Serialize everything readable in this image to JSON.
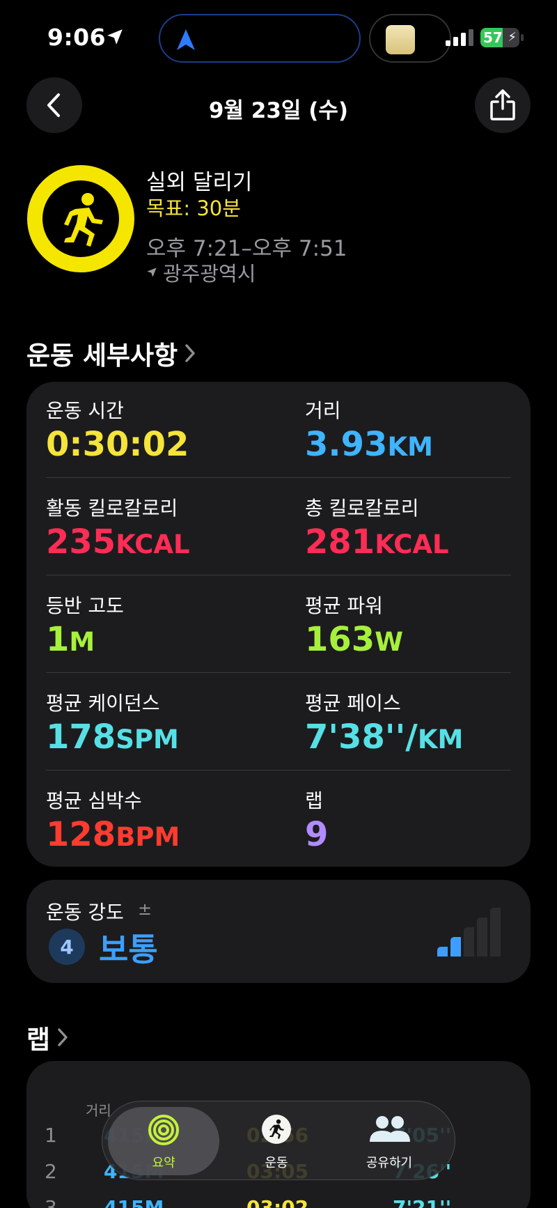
{
  "status_bar": {
    "time": "9:06",
    "battery": "57"
  },
  "nav": {
    "title": "9월 23일 (수)"
  },
  "workout": {
    "name": "실외 달리기",
    "goal": "목표: 30분",
    "time_range": "오후 7:21–오후 7:51",
    "location": "광주광역시"
  },
  "details": {
    "title": "운동 세부사항",
    "metrics": [
      {
        "label": "운동 시간",
        "value": "0:30:02",
        "unit": "",
        "color": "#f5e43a"
      },
      {
        "label": "거리",
        "value": "3.93",
        "unit": "KM",
        "color": "#3fb4ff"
      },
      {
        "label": "활동 킬로칼로리",
        "value": "235",
        "unit": "KCAL",
        "color": "#ff2d55"
      },
      {
        "label": "총 킬로칼로리",
        "value": "281",
        "unit": "KCAL",
        "color": "#ff2d55"
      },
      {
        "label": "등반 고도",
        "value": "1",
        "unit": "M",
        "color": "#a6f03b"
      },
      {
        "label": "평균 파워",
        "value": "163",
        "unit": "W",
        "color": "#a6f03b"
      },
      {
        "label": "평균 케이던스",
        "value": "178",
        "unit": "SPM",
        "color": "#56e0e6"
      },
      {
        "label": "평균 페이스",
        "value": "7'38''/",
        "unit": "KM",
        "color": "#56e0e6"
      },
      {
        "label": "평균 심박수",
        "value": "128",
        "unit": "BPM",
        "color": "#ff3b30"
      },
      {
        "label": "랩",
        "value": "9",
        "unit": "",
        "color": "#b18cff"
      }
    ]
  },
  "intensity": {
    "label": "운동 강도",
    "adjust_symbol": "±",
    "level": "4",
    "value": "보통",
    "level_fraction": 0.4
  },
  "laps": {
    "title": "랩",
    "header_distance": "거리",
    "rows": [
      {
        "n": "1",
        "distance": "415M",
        "time": "02:56",
        "pace": "7'05''"
      },
      {
        "n": "2",
        "distance": "415M",
        "time": "03:05",
        "pace": "7'26''"
      },
      {
        "n": "3",
        "distance": "415M",
        "time": "03:02",
        "pace": "7'21''"
      }
    ]
  },
  "tabbar": {
    "tabs": [
      {
        "label": "요약",
        "icon": "activity-rings-icon",
        "active": true
      },
      {
        "label": "운동",
        "icon": "running-figure-icon",
        "active": false
      },
      {
        "label": "공유하기",
        "icon": "people-icon",
        "active": false
      }
    ]
  }
}
